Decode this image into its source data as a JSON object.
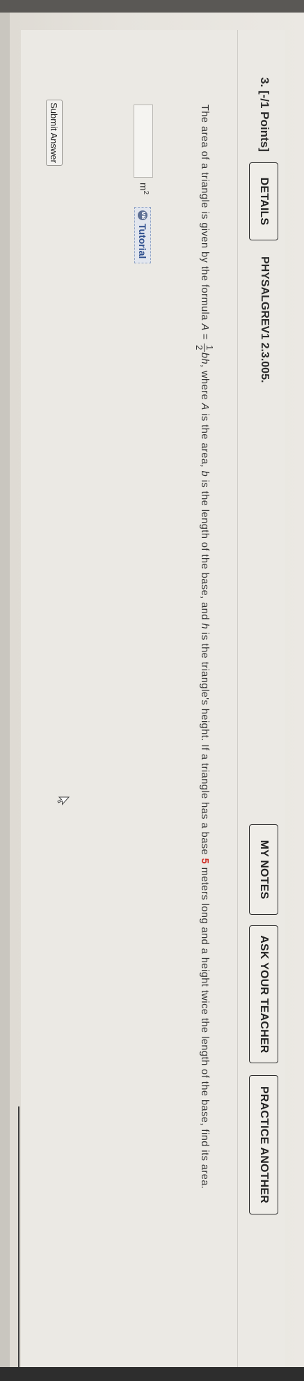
{
  "question": {
    "number_points": "3.  [-/1 Points]",
    "details_label": "DETAILS",
    "problem_id": "PHYSALGREV1 2.3.005.",
    "my_notes_label": "MY NOTES",
    "ask_teacher_label": "ASK YOUR TEACHER",
    "practice_another_label": "PRACTICE ANOTHER",
    "text_part1": "The area of a triangle is given by the formula ",
    "formula_lhs": "A = ",
    "frac_num": "1",
    "frac_den": "2",
    "formula_rhs": "bh",
    "text_part2": ", where ",
    "var_A": "A",
    "text_part3": " is the area, ",
    "var_b": "b",
    "text_part4": " is the length of the base, and ",
    "var_h": "h",
    "text_part5": " is the triangle's height. If a triangle has a base ",
    "base_value": "5",
    "text_part6": " meters long and a height twice the length of the base, find its area.",
    "answer_value": "",
    "unit": "m",
    "unit_exp": "2",
    "tutorial_icon_text": "MB",
    "tutorial_label": "Tutorial",
    "submit_label": "Submit Answer"
  },
  "icons": {
    "tutorial": "tutorial-icon",
    "cursor": "mouse-cursor-icon"
  }
}
